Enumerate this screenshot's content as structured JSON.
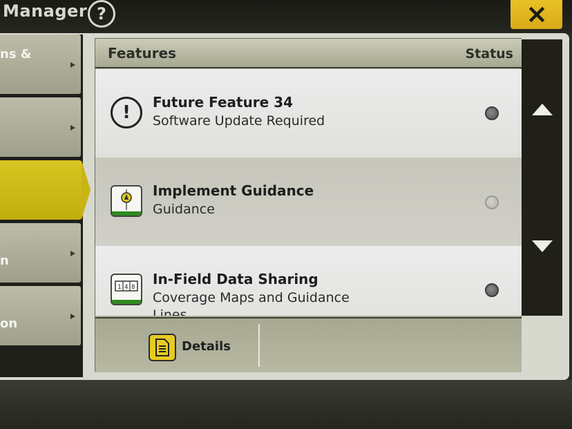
{
  "header": {
    "title": "Manager",
    "help_glyph": "?",
    "close_glyph": "✕"
  },
  "sidebar": {
    "items": [
      {
        "label": "ns &",
        "active": false
      },
      {
        "label": "",
        "active": false
      },
      {
        "label": "",
        "active": true
      },
      {
        "label": "n",
        "active": false
      },
      {
        "label": "on",
        "active": false
      }
    ]
  },
  "table": {
    "col_features": "Features",
    "col_status": "Status",
    "rows": [
      {
        "icon": "alert-icon",
        "title": "Future Feature 34",
        "subtitle": "Software Update Required",
        "status": "inactive"
      },
      {
        "icon": "implement-guidance-icon",
        "title": "Implement Guidance",
        "subtitle": "Guidance",
        "status": "unavailable"
      },
      {
        "icon": "data-sharing-icon",
        "title": "In-Field Data Sharing",
        "subtitle": "Coverage Maps and Guidance Lines",
        "status": "inactive"
      }
    ]
  },
  "footer": {
    "details_label": "Details"
  },
  "colors": {
    "accent_yellow": "#d8c521",
    "guidance_green": "#2f8a1f"
  }
}
